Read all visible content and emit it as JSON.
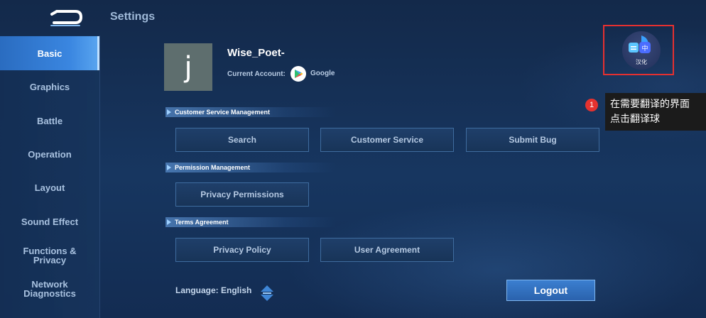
{
  "header": {
    "title": "Settings",
    "back_icon": "back-arrow-icon"
  },
  "sidebar": {
    "items": [
      {
        "label": "Basic",
        "active": true
      },
      {
        "label": "Graphics"
      },
      {
        "label": "Battle"
      },
      {
        "label": "Operation"
      },
      {
        "label": "Layout"
      },
      {
        "label": "Sound Effect"
      },
      {
        "label": "Functions & Privacy"
      },
      {
        "label": "Network Diagnostics"
      }
    ]
  },
  "profile": {
    "avatar_letter": "j",
    "username": "Wise_Poet-",
    "account_label": "Current Account:",
    "account_provider": "Google",
    "provider_icon": "google-play-icon"
  },
  "sections": {
    "customer_service": {
      "title": "Customer Service Management",
      "buttons": [
        "Search",
        "Customer Service",
        "Submit Bug"
      ]
    },
    "permission": {
      "title": "Permission Management",
      "buttons": [
        "Privacy Permissions"
      ]
    },
    "terms": {
      "title": "Terms Agreement",
      "buttons": [
        "Privacy Policy",
        "User Agreement"
      ]
    }
  },
  "footer": {
    "language": "Language: English",
    "logout": "Logout"
  },
  "translator": {
    "ball_label": "汉化",
    "ball_glyph": "中",
    "step_number": "1",
    "tooltip_line1": "在需要翻译的界面",
    "tooltip_line2": "点击翻译球"
  },
  "colors": {
    "background": "#173660",
    "active_tab": "#3a86e0",
    "highlight_box": "#e53030",
    "badge": "#e5322f"
  }
}
